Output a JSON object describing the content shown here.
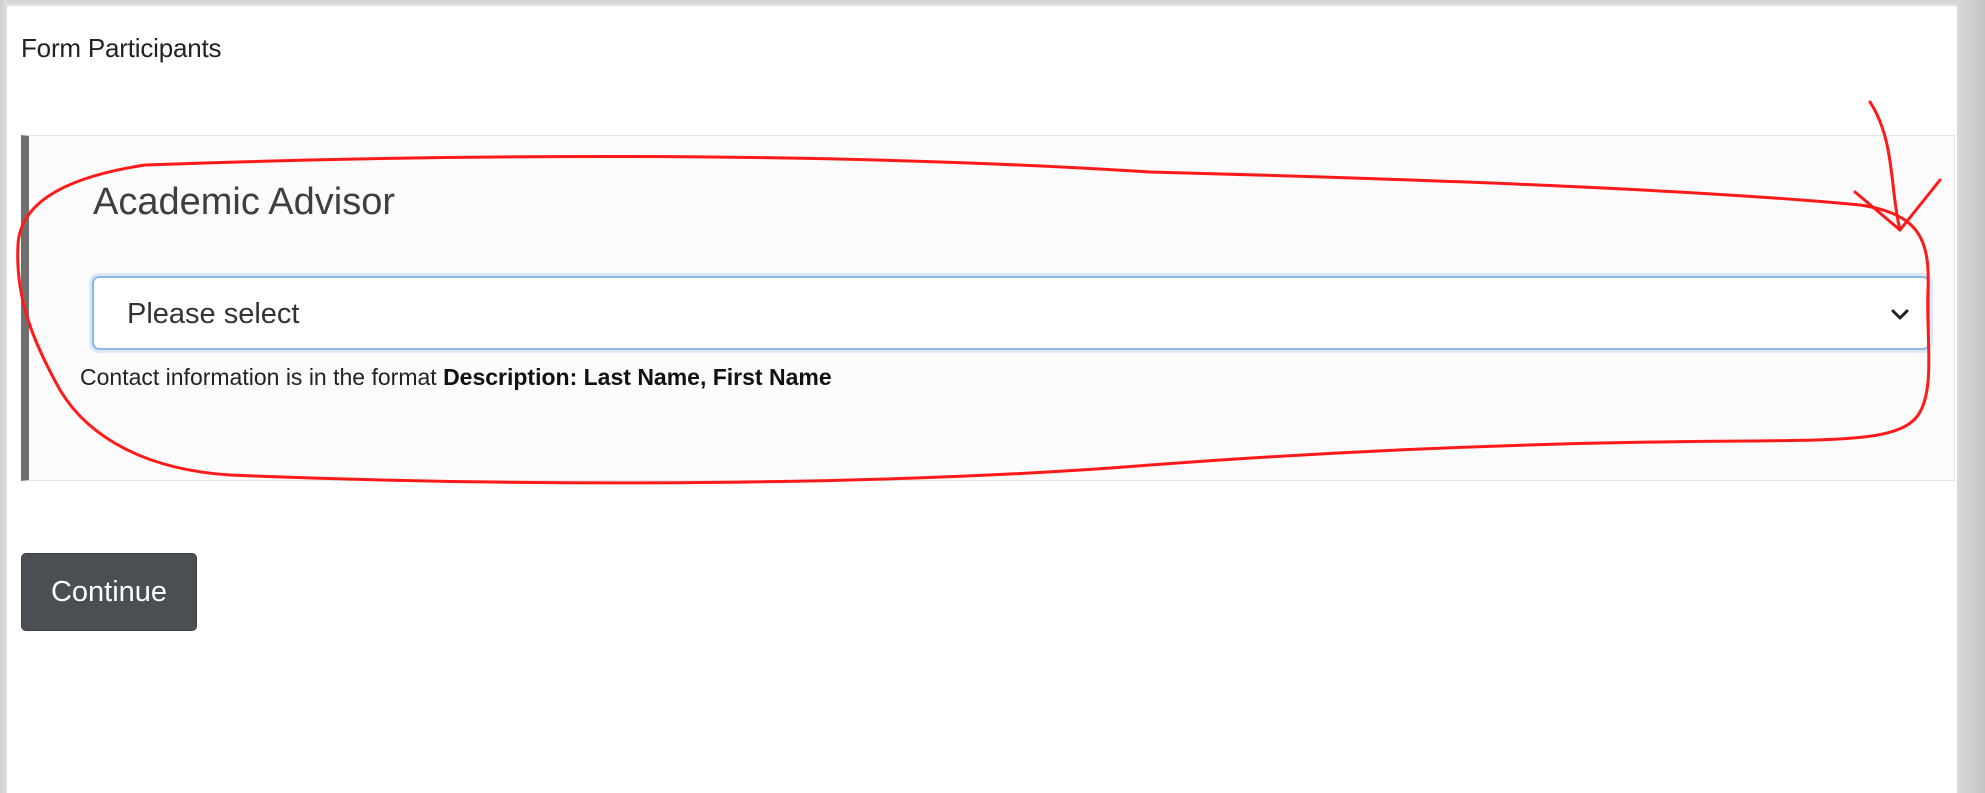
{
  "section": {
    "heading": "Form Participants"
  },
  "participant_panel": {
    "title": "Academic Advisor",
    "select": {
      "selected_value": "Please select"
    },
    "help": {
      "prefix": "Contact information is in the format ",
      "format": "Description: Last Name, First Name"
    }
  },
  "actions": {
    "continue_label": "Continue"
  },
  "annotation": {
    "color": "#ff0000",
    "shapes": [
      "freehand-circle",
      "arrow"
    ]
  },
  "colors": {
    "panel_accent": "#6f6f6f",
    "button_bg": "#4a4f54",
    "select_focus_border": "#8cb6e3"
  }
}
